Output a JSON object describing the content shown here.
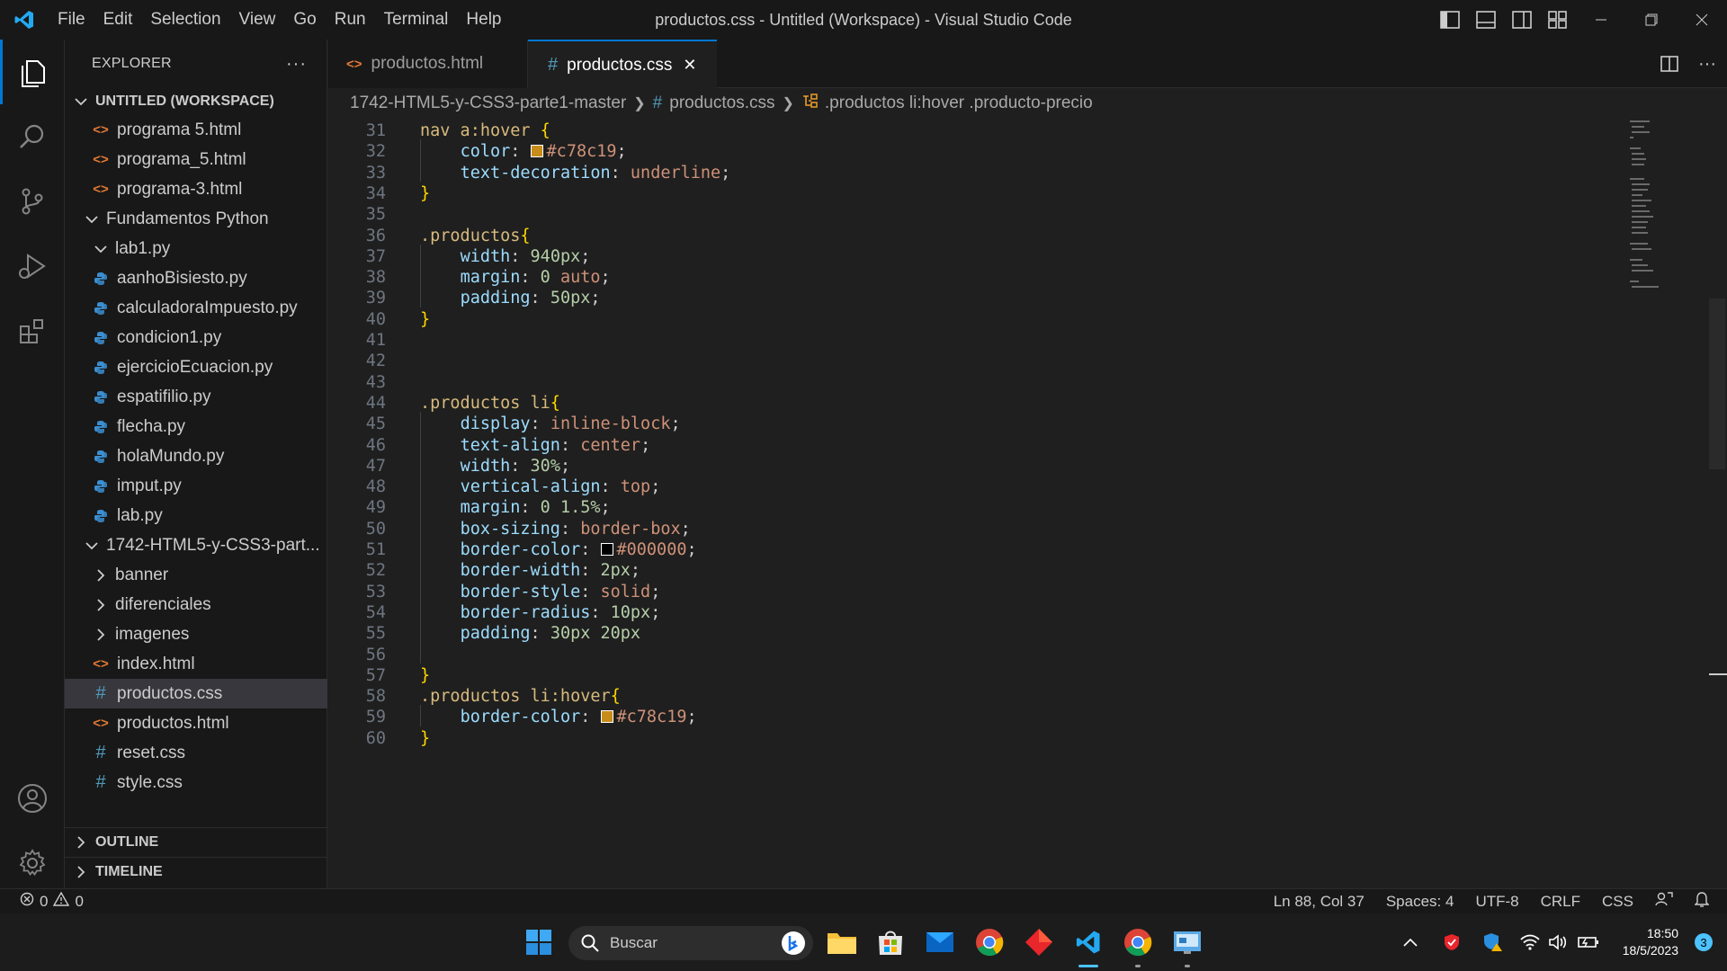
{
  "window": {
    "title": "productos.css - Untitled (Workspace) - Visual Studio Code",
    "menu": [
      "File",
      "Edit",
      "Selection",
      "View",
      "Go",
      "Run",
      "Terminal",
      "Help"
    ]
  },
  "explorer": {
    "header": "EXPLORER",
    "more": "···",
    "workspace": "UNTITLED (WORKSPACE)",
    "items": [
      {
        "label": "programa 5.html",
        "type": "html",
        "depth": 2
      },
      {
        "label": "programa_5.html",
        "type": "html",
        "depth": 2
      },
      {
        "label": "programa-3.html",
        "type": "html",
        "depth": 2
      },
      {
        "label": "Fundamentos Python",
        "type": "folder-open",
        "depth": 1
      },
      {
        "label": "lab1.py",
        "type": "folder-open",
        "depth": 2
      },
      {
        "label": "aanhoBisiesto.py",
        "type": "py",
        "depth": 2
      },
      {
        "label": "calculadoraImpuesto.py",
        "type": "py",
        "depth": 2
      },
      {
        "label": "condicion1.py",
        "type": "py",
        "depth": 2
      },
      {
        "label": "ejercicioEcuacion.py",
        "type": "py",
        "depth": 2
      },
      {
        "label": "espatifilio.py",
        "type": "py",
        "depth": 2
      },
      {
        "label": "flecha.py",
        "type": "py",
        "depth": 2
      },
      {
        "label": "holaMundo.py",
        "type": "py",
        "depth": 2
      },
      {
        "label": "imput.py",
        "type": "py",
        "depth": 2
      },
      {
        "label": "lab.py",
        "type": "py",
        "depth": 2
      },
      {
        "label": "1742-HTML5-y-CSS3-part...",
        "type": "folder-open",
        "depth": 1
      },
      {
        "label": "banner",
        "type": "folder",
        "depth": 2
      },
      {
        "label": "diferenciales",
        "type": "folder",
        "depth": 2
      },
      {
        "label": "imagenes",
        "type": "folder",
        "depth": 2
      },
      {
        "label": "index.html",
        "type": "html",
        "depth": 2
      },
      {
        "label": "productos.css",
        "type": "css",
        "depth": 2,
        "selected": true
      },
      {
        "label": "productos.html",
        "type": "html",
        "depth": 2
      },
      {
        "label": "reset.css",
        "type": "css",
        "depth": 2
      },
      {
        "label": "style.css",
        "type": "css",
        "depth": 2
      }
    ],
    "outline": "OUTLINE",
    "timeline": "TIMELINE"
  },
  "tabs": [
    {
      "label": "productos.html",
      "icon": "<>",
      "active": false
    },
    {
      "label": "productos.css",
      "icon": "#",
      "active": true,
      "close": "✕"
    }
  ],
  "breadcrumb": {
    "folder": "1742-HTML5-y-CSS3-parte1-master",
    "file": "productos.css",
    "symbol": ".productos li:hover .producto-precio"
  },
  "code": {
    "first_line": 31,
    "lines": [
      [
        [
          "nav a:hover ",
          "sel"
        ],
        [
          "{",
          "brace"
        ]
      ],
      [
        [
          "    "
        ],
        [
          "color",
          "prop"
        ],
        [
          ": ",
          "pun"
        ],
        [
          "#c78c19",
          "swatch"
        ],
        [
          "#c78c19",
          "val"
        ],
        [
          ";",
          "pun"
        ]
      ],
      [
        [
          "    "
        ],
        [
          "text-decoration",
          "prop"
        ],
        [
          ": ",
          "pun"
        ],
        [
          "underline",
          "val"
        ],
        [
          ";",
          "pun"
        ]
      ],
      [
        [
          "}",
          "brace"
        ]
      ],
      [],
      [
        [
          ".productos",
          "sel"
        ],
        [
          "{",
          "brace"
        ]
      ],
      [
        [
          "    "
        ],
        [
          "width",
          "prop"
        ],
        [
          ": ",
          "pun"
        ],
        [
          "940px",
          "num"
        ],
        [
          ";",
          "pun"
        ]
      ],
      [
        [
          "    "
        ],
        [
          "margin",
          "prop"
        ],
        [
          ": ",
          "pun"
        ],
        [
          "0 ",
          "num"
        ],
        [
          "auto",
          "val"
        ],
        [
          ";",
          "pun"
        ]
      ],
      [
        [
          "    "
        ],
        [
          "padding",
          "prop"
        ],
        [
          ": ",
          "pun"
        ],
        [
          "50px",
          "num"
        ],
        [
          ";",
          "pun"
        ]
      ],
      [
        [
          "}",
          "brace"
        ]
      ],
      [],
      [],
      [],
      [
        [
          ".productos li",
          "sel"
        ],
        [
          "{",
          "brace"
        ]
      ],
      [
        [
          "    "
        ],
        [
          "display",
          "prop"
        ],
        [
          ": ",
          "pun"
        ],
        [
          "inline-block",
          "val"
        ],
        [
          ";",
          "pun"
        ]
      ],
      [
        [
          "    "
        ],
        [
          "text-align",
          "prop"
        ],
        [
          ": ",
          "pun"
        ],
        [
          "center",
          "val"
        ],
        [
          ";",
          "pun"
        ]
      ],
      [
        [
          "    "
        ],
        [
          "width",
          "prop"
        ],
        [
          ": ",
          "pun"
        ],
        [
          "30%",
          "num"
        ],
        [
          ";",
          "pun"
        ]
      ],
      [
        [
          "    "
        ],
        [
          "vertical-align",
          "prop"
        ],
        [
          ": ",
          "pun"
        ],
        [
          "top",
          "val"
        ],
        [
          ";",
          "pun"
        ]
      ],
      [
        [
          "    "
        ],
        [
          "margin",
          "prop"
        ],
        [
          ": ",
          "pun"
        ],
        [
          "0 1.5%",
          "num"
        ],
        [
          ";",
          "pun"
        ]
      ],
      [
        [
          "    "
        ],
        [
          "box-sizing",
          "prop"
        ],
        [
          ": ",
          "pun"
        ],
        [
          "border-box",
          "val"
        ],
        [
          ";",
          "pun"
        ]
      ],
      [
        [
          "    "
        ],
        [
          "border-color",
          "prop"
        ],
        [
          ": ",
          "pun"
        ],
        [
          "#000000",
          "swatch"
        ],
        [
          "#000000",
          "val"
        ],
        [
          ";",
          "pun"
        ]
      ],
      [
        [
          "    "
        ],
        [
          "border-width",
          "prop"
        ],
        [
          ": ",
          "pun"
        ],
        [
          "2px",
          "num"
        ],
        [
          ";",
          "pun"
        ]
      ],
      [
        [
          "    "
        ],
        [
          "border-style",
          "prop"
        ],
        [
          ": ",
          "pun"
        ],
        [
          "solid",
          "val"
        ],
        [
          ";",
          "pun"
        ]
      ],
      [
        [
          "    "
        ],
        [
          "border-radius",
          "prop"
        ],
        [
          ": ",
          "pun"
        ],
        [
          "10px",
          "num"
        ],
        [
          ";",
          "pun"
        ]
      ],
      [
        [
          "    "
        ],
        [
          "padding",
          "prop"
        ],
        [
          ": ",
          "pun"
        ],
        [
          "30px 20px",
          "num"
        ]
      ],
      [],
      [
        [
          "}",
          "brace"
        ]
      ],
      [
        [
          ".productos li:hover",
          "sel"
        ],
        [
          "{",
          "brace"
        ]
      ],
      [
        [
          "    "
        ],
        [
          "border-color",
          "prop"
        ],
        [
          ": ",
          "pun"
        ],
        [
          "#c78c19",
          "swatch"
        ],
        [
          "#c78c19",
          "val"
        ],
        [
          ";",
          "pun"
        ]
      ],
      [
        [
          "}",
          "brace"
        ]
      ]
    ]
  },
  "status": {
    "errors": "0",
    "warnings": "0",
    "position": "Ln 88, Col 37",
    "spaces": "Spaces: 4",
    "encoding": "UTF-8",
    "eol": "CRLF",
    "language": "CSS"
  },
  "taskbar": {
    "search_placeholder": "Buscar",
    "time": "18:50",
    "date": "18/5/2023",
    "notifications": "3"
  },
  "colors": {
    "accent": "#0078d4",
    "swatch_gold": "#c78c19",
    "swatch_black": "#000000"
  }
}
